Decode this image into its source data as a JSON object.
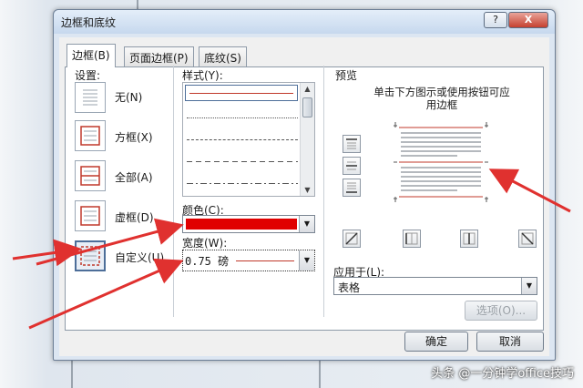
{
  "dialog": {
    "title": "边框和底纹",
    "help_label": "?",
    "close_label": "X"
  },
  "tabs": [
    {
      "label": "边框(B)",
      "active": true
    },
    {
      "label": "页面边框(P)",
      "active": false
    },
    {
      "label": "底纹(S)",
      "active": false
    }
  ],
  "settings": {
    "heading": "设置:",
    "items": [
      {
        "label": "无(N)",
        "icon": "setting-none-icon"
      },
      {
        "label": "方框(X)",
        "icon": "setting-box-icon"
      },
      {
        "label": "全部(A)",
        "icon": "setting-all-icon"
      },
      {
        "label": "虚框(D)",
        "icon": "setting-grid-icon"
      },
      {
        "label": "自定义(U)",
        "icon": "setting-custom-icon"
      }
    ]
  },
  "style": {
    "label": "样式(Y):"
  },
  "color": {
    "label": "颜色(C):",
    "value_color": "#e00000"
  },
  "width": {
    "label": "宽度(W):",
    "value": "0.75 磅"
  },
  "preview": {
    "heading": "预览",
    "hint": "单击下方图示或使用按钮可应用边框"
  },
  "apply_to": {
    "label": "应用于(L):",
    "value": "表格"
  },
  "buttons": {
    "options": "选项(O)...",
    "ok": "确定",
    "cancel": "取消"
  },
  "watermark": "头条 @一分钟学office技巧",
  "colors": {
    "accent_red": "#e00000",
    "arrow_red": "#e0312f"
  }
}
